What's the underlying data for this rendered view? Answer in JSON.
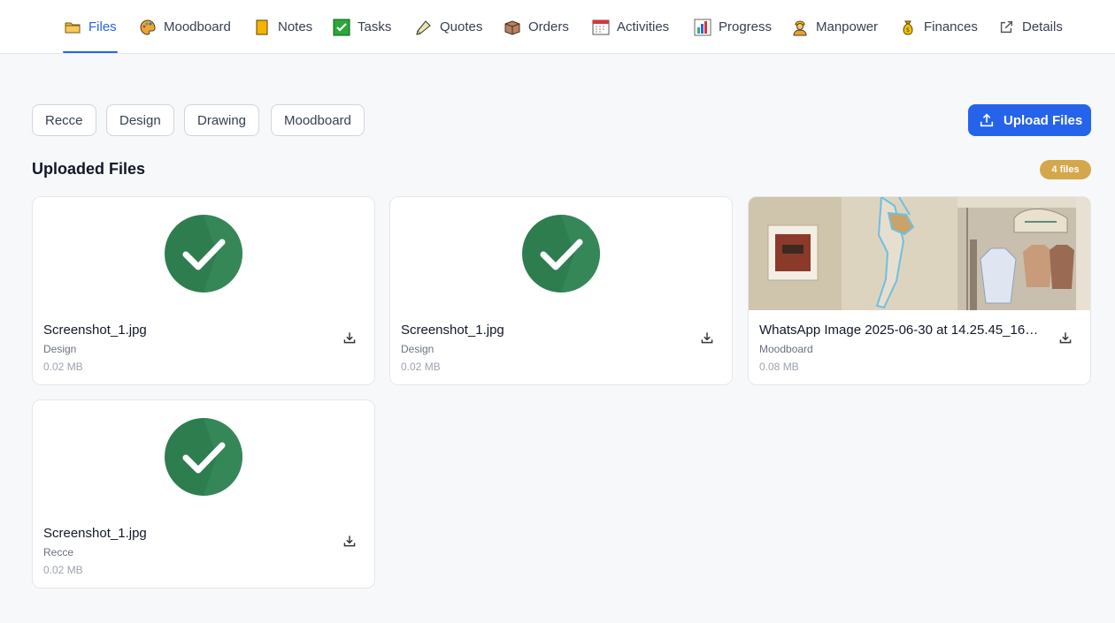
{
  "nav": {
    "tabs": [
      {
        "label": "Files",
        "icon": "folder-icon",
        "active": true
      },
      {
        "label": "Moodboard",
        "icon": "palette-icon"
      },
      {
        "label": "Notes",
        "icon": "note-icon"
      },
      {
        "label": "Tasks",
        "icon": "check-box-icon"
      },
      {
        "label": "Quotes",
        "icon": "quote-icon"
      },
      {
        "label": "Orders",
        "icon": "box-icon"
      },
      {
        "label": "Activities",
        "icon": "calendar-icon"
      },
      {
        "label": "Progress",
        "icon": "bar-chart-icon"
      },
      {
        "label": "Manpower",
        "icon": "worker-icon"
      },
      {
        "label": "Finances",
        "icon": "money-bag-icon"
      },
      {
        "label": "Details",
        "icon": "external-link-icon"
      }
    ]
  },
  "filters": [
    {
      "label": "Recce"
    },
    {
      "label": "Design"
    },
    {
      "label": "Drawing"
    },
    {
      "label": "Moodboard"
    }
  ],
  "upload": {
    "label": "Upload Files",
    "icon": "upload-icon"
  },
  "section": {
    "title": "Uploaded Files",
    "count": "4 files"
  },
  "files": [
    {
      "name": "Screenshot_1.jpg",
      "category": "Design",
      "size": "0.02 MB",
      "thumb": "check-thumb"
    },
    {
      "name": "Screenshot_1.jpg",
      "category": "Design",
      "size": "0.02 MB",
      "thumb": "check-thumb"
    },
    {
      "name": "WhatsApp Image 2025-06-30 at 14.25.45_164...",
      "category": "Moodboard",
      "size": "0.08 MB",
      "thumb": "photo-thumb"
    },
    {
      "name": "Screenshot_1.jpg",
      "category": "Recce",
      "size": "0.02 MB",
      "thumb": "check-thumb"
    }
  ],
  "colors": {
    "accent": "#2563eb",
    "badge": "#d4a74a",
    "check": "#2e7d4f"
  }
}
